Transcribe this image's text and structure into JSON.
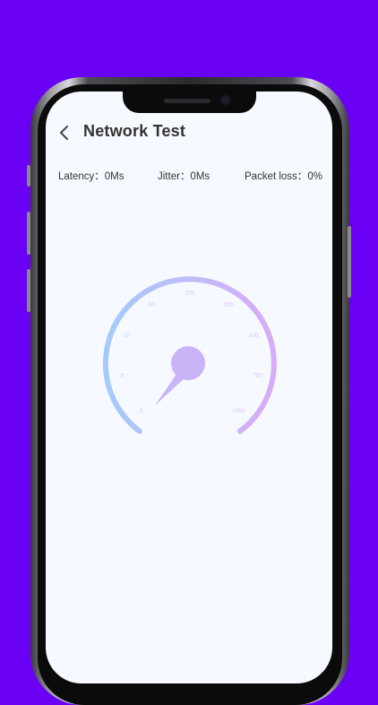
{
  "header": {
    "title": "Network Test"
  },
  "stats": {
    "latency_label": "Latency：",
    "latency_value": "0Ms",
    "jitter_label": "Jitter：",
    "jitter_value": "0Ms",
    "packet_loss_label": "Packet loss：",
    "packet_loss_value": "0%"
  },
  "gauge": {
    "ticks": [
      "0",
      "5",
      "10",
      "50",
      "100",
      "250",
      "500",
      "750",
      "1000"
    ],
    "speed_value": 0,
    "colors": {
      "start": "#a6cbfb",
      "end": "#d8acf6",
      "hub": "#c9b4f7"
    }
  }
}
